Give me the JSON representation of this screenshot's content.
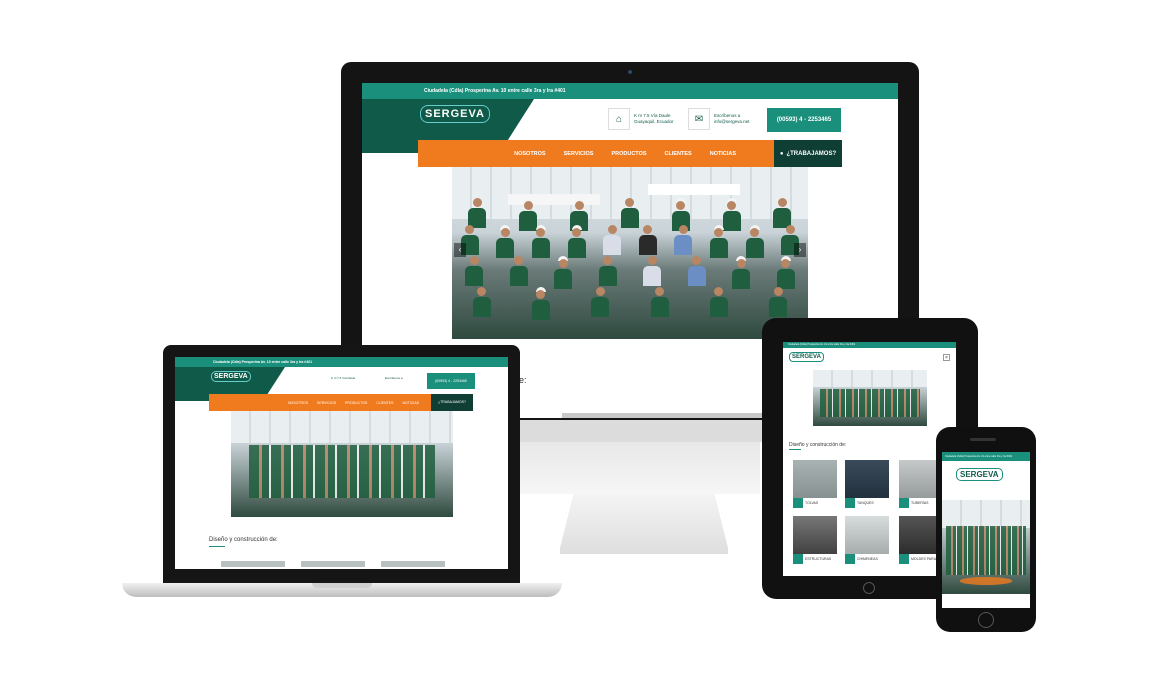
{
  "site": {
    "address": "Ciudadela (Cdla) Prosperina Av. 10 entre calle 3ra y Ira #401",
    "logo": "SERGEVA",
    "contact_location_line1": "K m 7.5 Vía Daule",
    "contact_location_line2": "Guayaquil, Ecuador",
    "contact_email_line1": "Escríbenos a",
    "contact_email_line2": "info@sergeva.net",
    "phone": "(00593) 4 - 2253465",
    "nav": [
      "NOSOTROS",
      "SERVICIOS",
      "PRODUCTOS",
      "CLIENTES",
      "NOTICIAS"
    ],
    "cta": "¿TRABAJAMOS?",
    "section_title": "Diseño y construcción de:",
    "section_title_cut": "de:"
  },
  "tablet": {
    "tiles": [
      "TOLVAS",
      "TANQUES",
      "TUBERÍAS ESPECIALES",
      "ESTRUCTURAS DE ACERO",
      "CHIMENEAS",
      "MOLDES PARA PREFABRICADOS"
    ]
  },
  "icons": {
    "home": "home-icon",
    "mail": "mail-icon",
    "globe": "globe-icon",
    "arrow_left": "arrow-left-icon",
    "arrow_right": "arrow-right-icon",
    "close": "close-icon"
  },
  "colors": {
    "teal": "#1a8f7c",
    "dark_green": "#0f5a49",
    "orange": "#f07a1e",
    "nav_dark": "#0f3f34"
  }
}
